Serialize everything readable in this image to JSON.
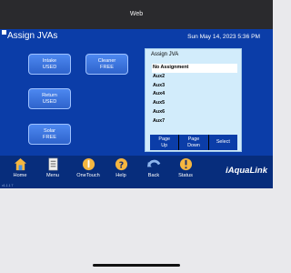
{
  "window": {
    "title": "Web"
  },
  "header": {
    "title": "Assign JVAs",
    "datetime": "Sun May 14, 2023 5:36 PM"
  },
  "pumps": [
    {
      "name": "Intake",
      "status": "USED"
    },
    {
      "name": "Cleaner",
      "status": "FREE"
    },
    {
      "name": "Return",
      "status": "USED"
    },
    {
      "name": "Solar",
      "status": "FREE"
    }
  ],
  "panel": {
    "title": "Assign JVA",
    "items": [
      "No Assignment",
      "Aux2",
      "Aux3",
      "Aux4",
      "Aux5",
      "Aux6",
      "Aux7"
    ],
    "selected_index": 0,
    "buttons": [
      {
        "line1": "Page",
        "line2": "Up"
      },
      {
        "line1": "Page",
        "line2": "Down"
      },
      {
        "line1": "Select",
        "line2": ""
      }
    ]
  },
  "nav": [
    "Home",
    "Menu",
    "OneTouch",
    "Help",
    "Back",
    "Status"
  ],
  "brand": "iAquaLink",
  "footer_tiny": "v1.1.1 7",
  "colors": {
    "screen_bg": "#0b3da8",
    "button": "#3a74e0",
    "panel_bg": "#d2ecfb",
    "nav_bg": "#072d7c"
  }
}
